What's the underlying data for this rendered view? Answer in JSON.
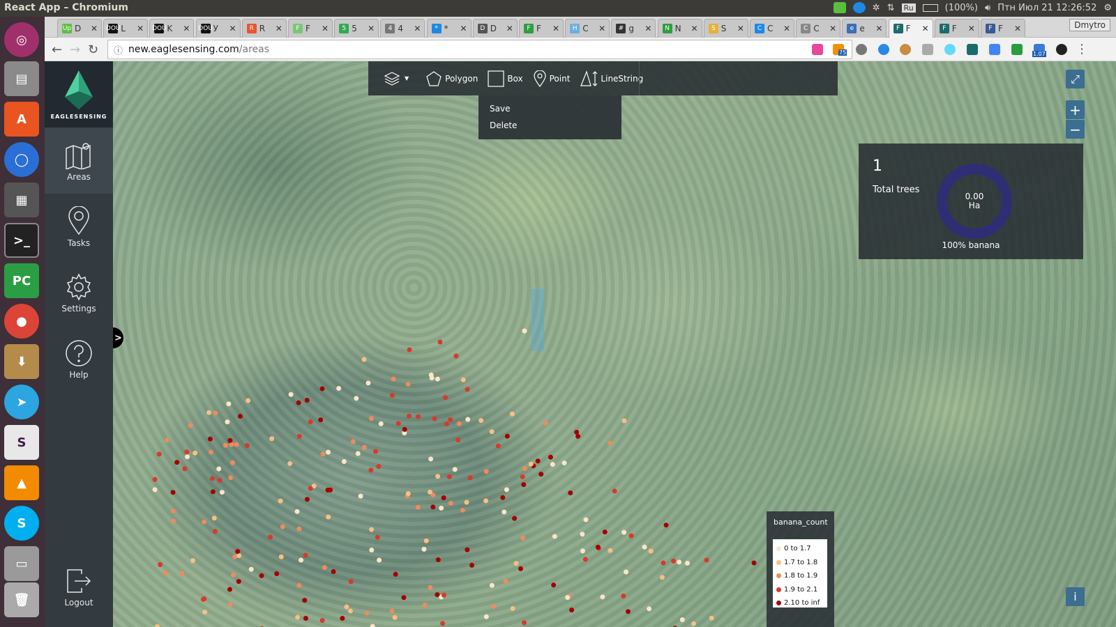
{
  "topbar": {
    "title": "React App – Chromium",
    "keyboard": "Ru",
    "battery": "(100%)",
    "datetime": "Птн Июл 21 12:26:52"
  },
  "tabs": [
    {
      "icon": "Up",
      "label": "D"
    },
    {
      "icon": "DOU",
      "label": "L"
    },
    {
      "icon": "DOU",
      "label": "K"
    },
    {
      "icon": "DOU",
      "label": "У"
    },
    {
      "icon": "R",
      "label": "R"
    },
    {
      "icon": "F",
      "label": "F"
    },
    {
      "icon": "5",
      "label": "5"
    },
    {
      "icon": "4",
      "label": "4"
    },
    {
      "icon": "*",
      "label": "*"
    },
    {
      "icon": "D",
      "label": "D"
    },
    {
      "icon": "F",
      "label": "F"
    },
    {
      "icon": "H",
      "label": "C"
    },
    {
      "icon": "#",
      "label": "g"
    },
    {
      "icon": "N",
      "label": "N"
    },
    {
      "icon": "S",
      "label": "S"
    },
    {
      "icon": "C",
      "label": "C"
    },
    {
      "icon": "C",
      "label": "C"
    },
    {
      "icon": "e",
      "label": "e"
    },
    {
      "icon": "F",
      "label": "F"
    },
    {
      "icon": "F",
      "label": "F"
    },
    {
      "icon": "F",
      "label": "F"
    }
  ],
  "profile": "Dmytro",
  "address": {
    "host": "new.eaglesensing.com",
    "path": "/areas"
  },
  "ext_badges": {
    "rss": "75",
    "speed": "1.07"
  },
  "sidebar": {
    "brand": "EAGLESENSING",
    "items": [
      {
        "label": "Areas"
      },
      {
        "label": "Tasks"
      },
      {
        "label": "Settings"
      },
      {
        "label": "Help"
      }
    ],
    "logout": "Logout"
  },
  "draw_toolbar": {
    "polygon": "Polygon",
    "box": "Box",
    "point": "Point",
    "linestring": "LineString"
  },
  "dropdown": {
    "save": "Save",
    "delete": "Delete"
  },
  "map_controls": {
    "zoom_in": "+",
    "zoom_out": "−",
    "info": "i",
    "expand": "⤢"
  },
  "stats": {
    "count": "1",
    "label": "Total trees",
    "area": "0.00",
    "unit": "Ha",
    "composition": "100% banana",
    "donut_color": "#2e2e75"
  },
  "legend": {
    "title": "banana_count",
    "items": [
      {
        "label": "0 to 1.7",
        "color": "#fde5c8"
      },
      {
        "label": "1.7 to 1.8",
        "color": "#f8bf86"
      },
      {
        "label": "1.8 to 1.9",
        "color": "#f08a5e"
      },
      {
        "label": "1.9 to 2.1",
        "color": "#d8392b"
      },
      {
        "label": "2.10 to inf",
        "color": "#a40000"
      }
    ]
  },
  "sidebar_toggle": ">"
}
